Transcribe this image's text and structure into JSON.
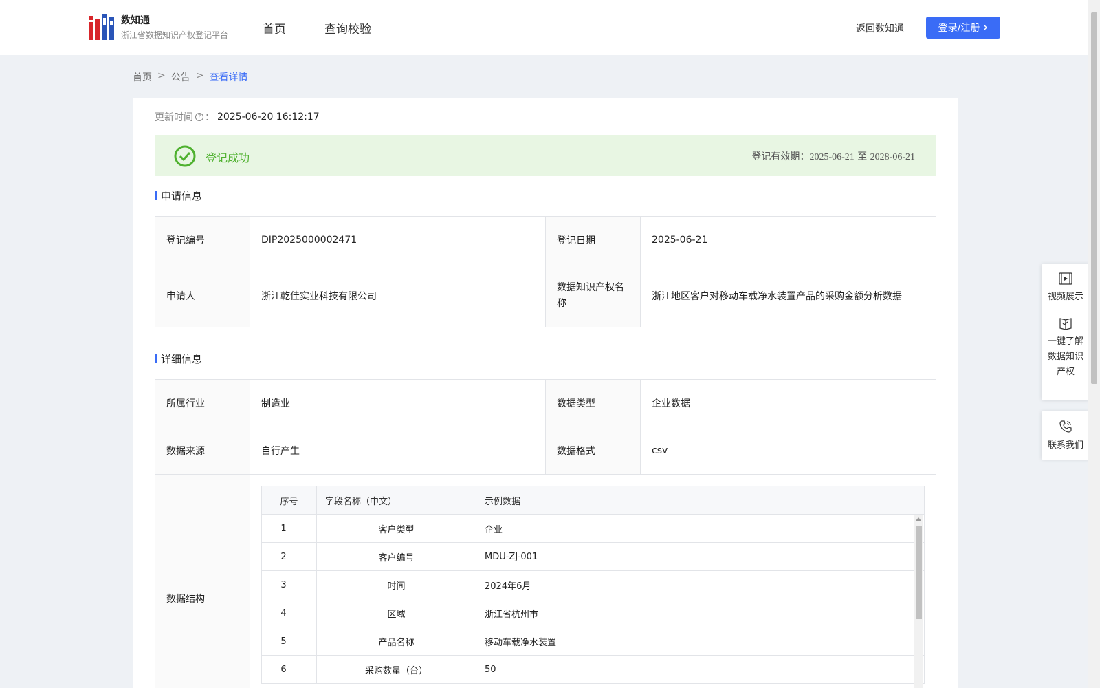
{
  "header": {
    "brand_name": "数知通",
    "brand_sub": "浙江省数据知识产权登记平台",
    "nav": [
      "首页",
      "查询校验"
    ],
    "back_link": "返回数知通",
    "login_button": "登录/注册"
  },
  "breadcrumb": {
    "home": "首页",
    "notice": "公告",
    "current": "查看详情",
    "separator": ">"
  },
  "update": {
    "label": "更新时间",
    "colon": "：",
    "value": "2025-06-20 16:12:17"
  },
  "status": {
    "text": "登记成功",
    "validity_label": "登记有效期：",
    "validity_start": "2025-06-21",
    "validity_to": "至",
    "validity_end": "2028-06-21",
    "color": "#4fb12f"
  },
  "application": {
    "title": "申请信息",
    "reg_no_label": "登记编号",
    "reg_no": "DIP2025000002471",
    "reg_date_label": "登记日期",
    "reg_date": "2025-06-21",
    "applicant_label": "申请人",
    "applicant": "浙江乾佳实业科技有限公司",
    "ip_name_label": "数据知识产权名称",
    "ip_name": "浙江地区客户对移动车载净水装置产品的采购金额分析数据"
  },
  "detail": {
    "title": "详细信息",
    "industry_label": "所属行业",
    "industry": "制造业",
    "data_type_label": "数据类型",
    "data_type": "企业数据",
    "source_label": "数据来源",
    "source": "自行产生",
    "format_label": "数据格式",
    "format": "csv",
    "structure_label": "数据结构",
    "structure_headers": [
      "序号",
      "字段名称（中文）",
      "示例数据"
    ],
    "structure_rows": [
      {
        "idx": "1",
        "name": "客户类型",
        "example": "企业"
      },
      {
        "idx": "2",
        "name": "客户编号",
        "example": "MDU-ZJ-001"
      },
      {
        "idx": "3",
        "name": "时间",
        "example": "2024年6月"
      },
      {
        "idx": "4",
        "name": "区域",
        "example": "浙江省杭州市"
      },
      {
        "idx": "5",
        "name": "产品名称",
        "example": "移动车载净水装置"
      },
      {
        "idx": "6",
        "name": "采购数量（台）",
        "example": "50"
      }
    ]
  },
  "side_panel": {
    "video": "视频展示",
    "learn_lines": [
      "一键了解",
      "数据知识",
      "产权"
    ],
    "contact": "联系我们"
  },
  "colors": {
    "accent": "#3a6cf6",
    "success_bg": "#e8f6e3"
  }
}
